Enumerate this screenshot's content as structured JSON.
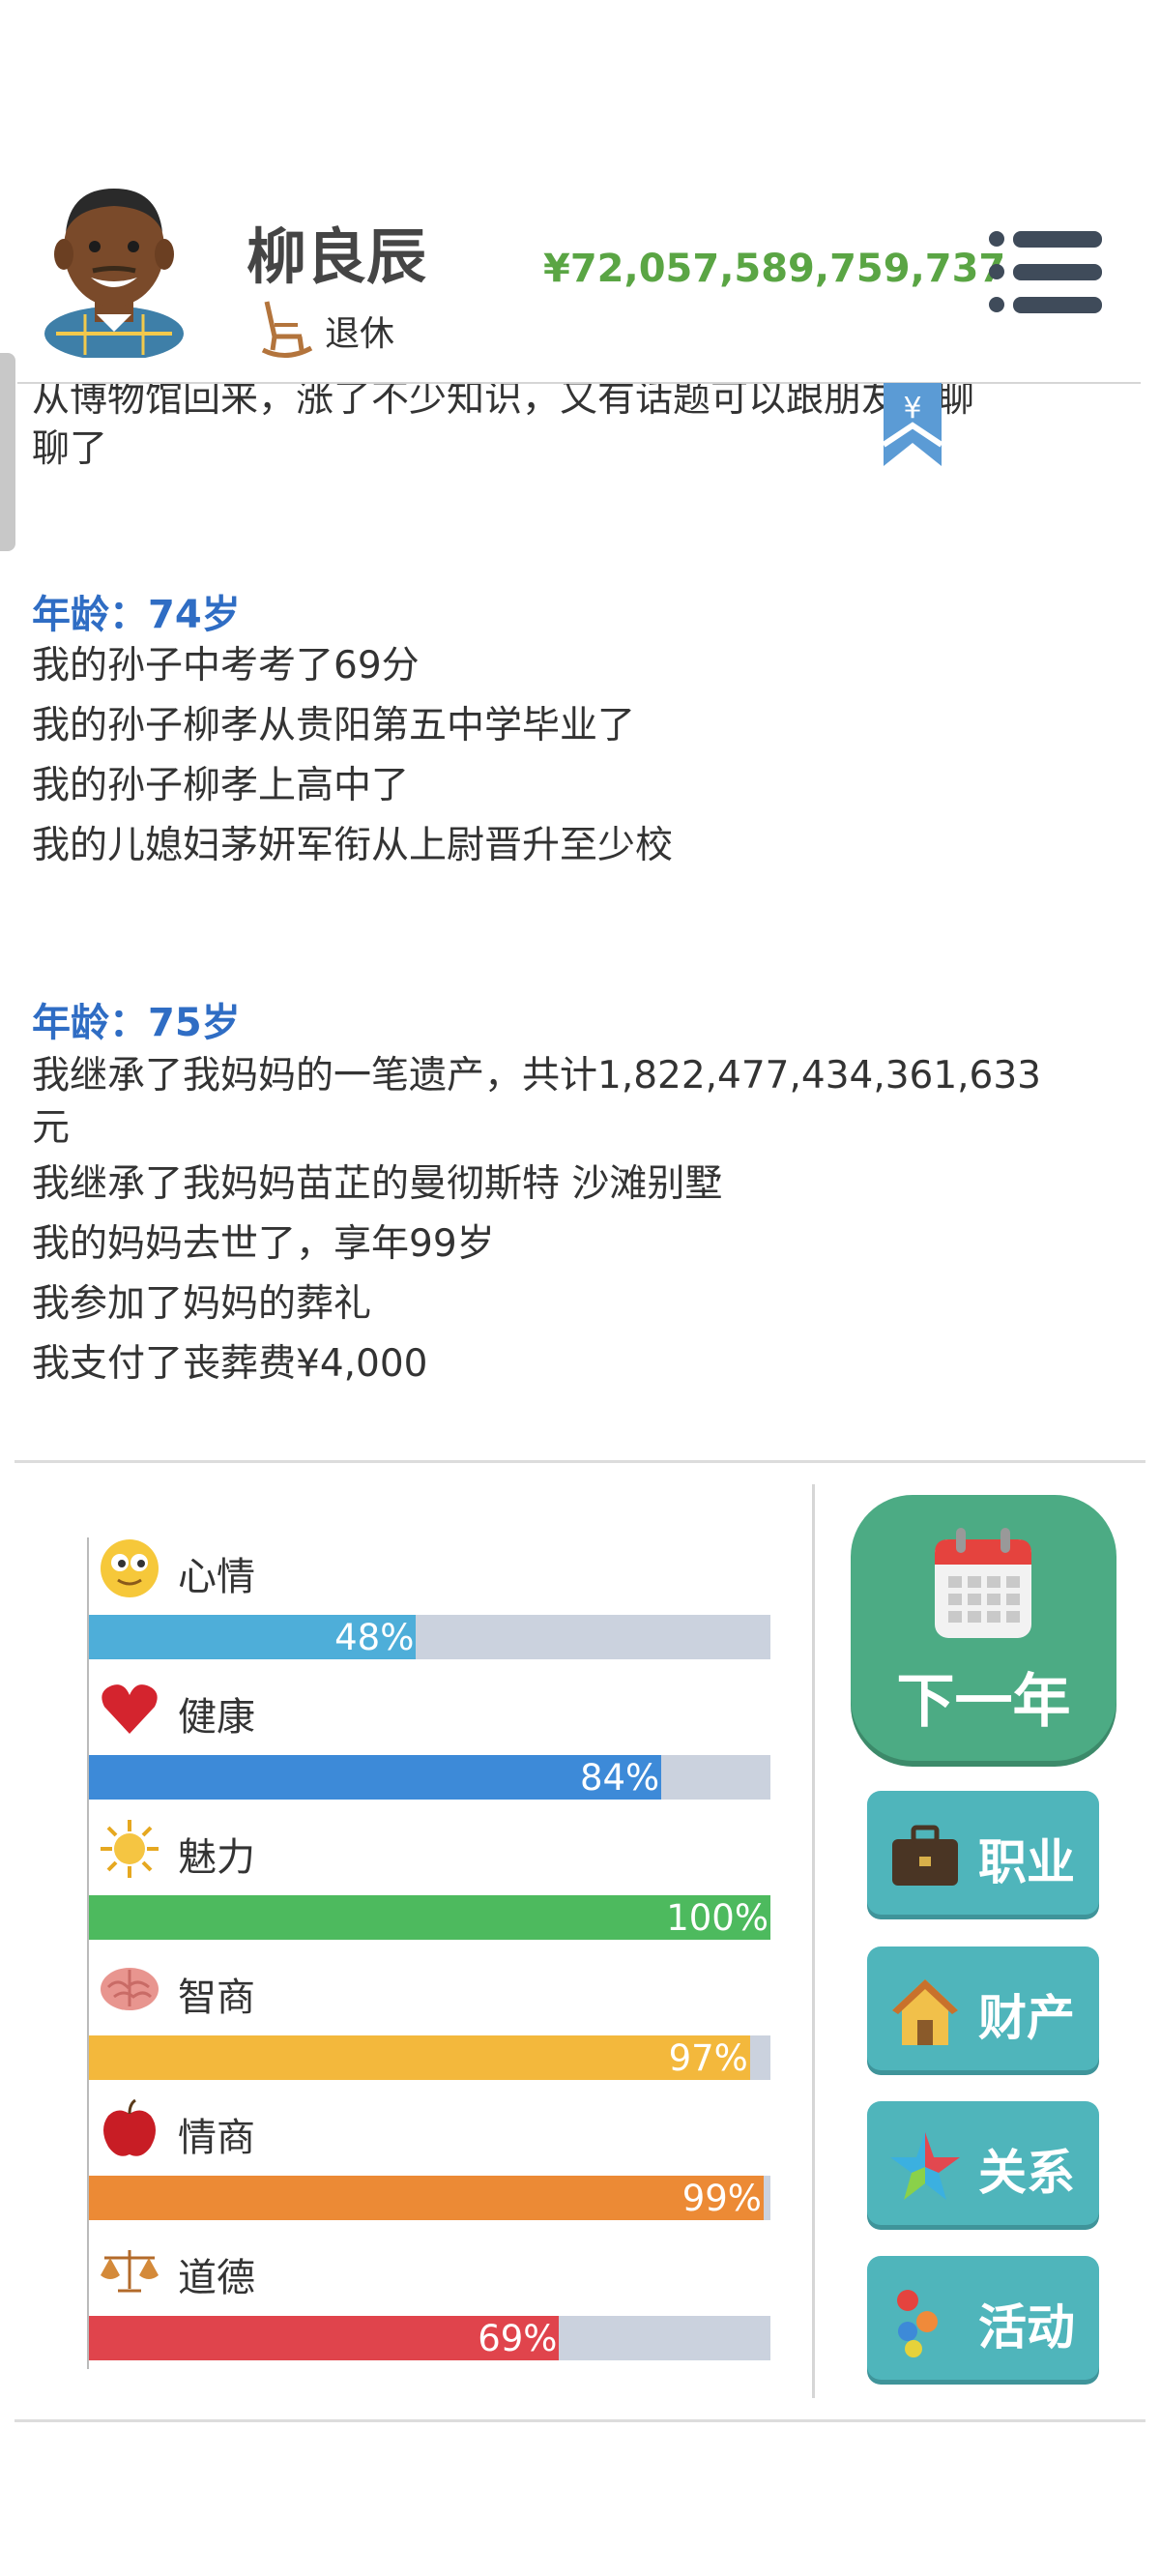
{
  "header": {
    "name": "柳良辰",
    "job": "退休",
    "money": "¥72,057,589,759,737",
    "bookmark_symbol": "¥"
  },
  "log": {
    "lines": [
      "从博物馆回来，涨了不少知识，又有话题可以跟朋友们聊",
      "聊了"
    ],
    "sections": [
      {
        "age": "年龄：74岁",
        "events": [
          "我的孙子中考考了69分",
          "我的孙子柳孝从贵阳第五中学毕业了",
          "我的孙子柳孝上高中了",
          "我的儿媳妇茅妍军衔从上尉晋升至少校"
        ]
      },
      {
        "age": "年龄：75岁",
        "events": [
          "我继承了我妈妈的一笔遗产，共计1,822,477,434,361,633",
          "元",
          "我继承了我妈妈苗芷的曼彻斯特 沙滩别墅",
          "我的妈妈去世了，享年99岁",
          "我参加了妈妈的葬礼",
          "我支付了丧葬费¥4,000"
        ]
      }
    ]
  },
  "stats": [
    {
      "label": "心情",
      "value": 48,
      "display": "48%",
      "color": "#4eaed9",
      "icon": "smiley-icon"
    },
    {
      "label": "健康",
      "value": 84,
      "display": "84%",
      "color": "#3d8ad8",
      "icon": "heart-icon"
    },
    {
      "label": "魅力",
      "value": 100,
      "display": "100%",
      "color": "#4dba5e",
      "icon": "sun-icon"
    },
    {
      "label": "智商",
      "value": 97,
      "display": "97%",
      "color": "#f3b83c",
      "icon": "brain-icon"
    },
    {
      "label": "情商",
      "value": 99,
      "display": "99%",
      "color": "#ec8a35",
      "icon": "apple-icon"
    },
    {
      "label": "道德",
      "value": 69,
      "display": "69%",
      "color": "#e0444c",
      "icon": "scales-icon"
    }
  ],
  "actions": {
    "next_year": "下一年",
    "career": "职业",
    "assets": "财产",
    "relations": "关系",
    "activities": "活动"
  }
}
